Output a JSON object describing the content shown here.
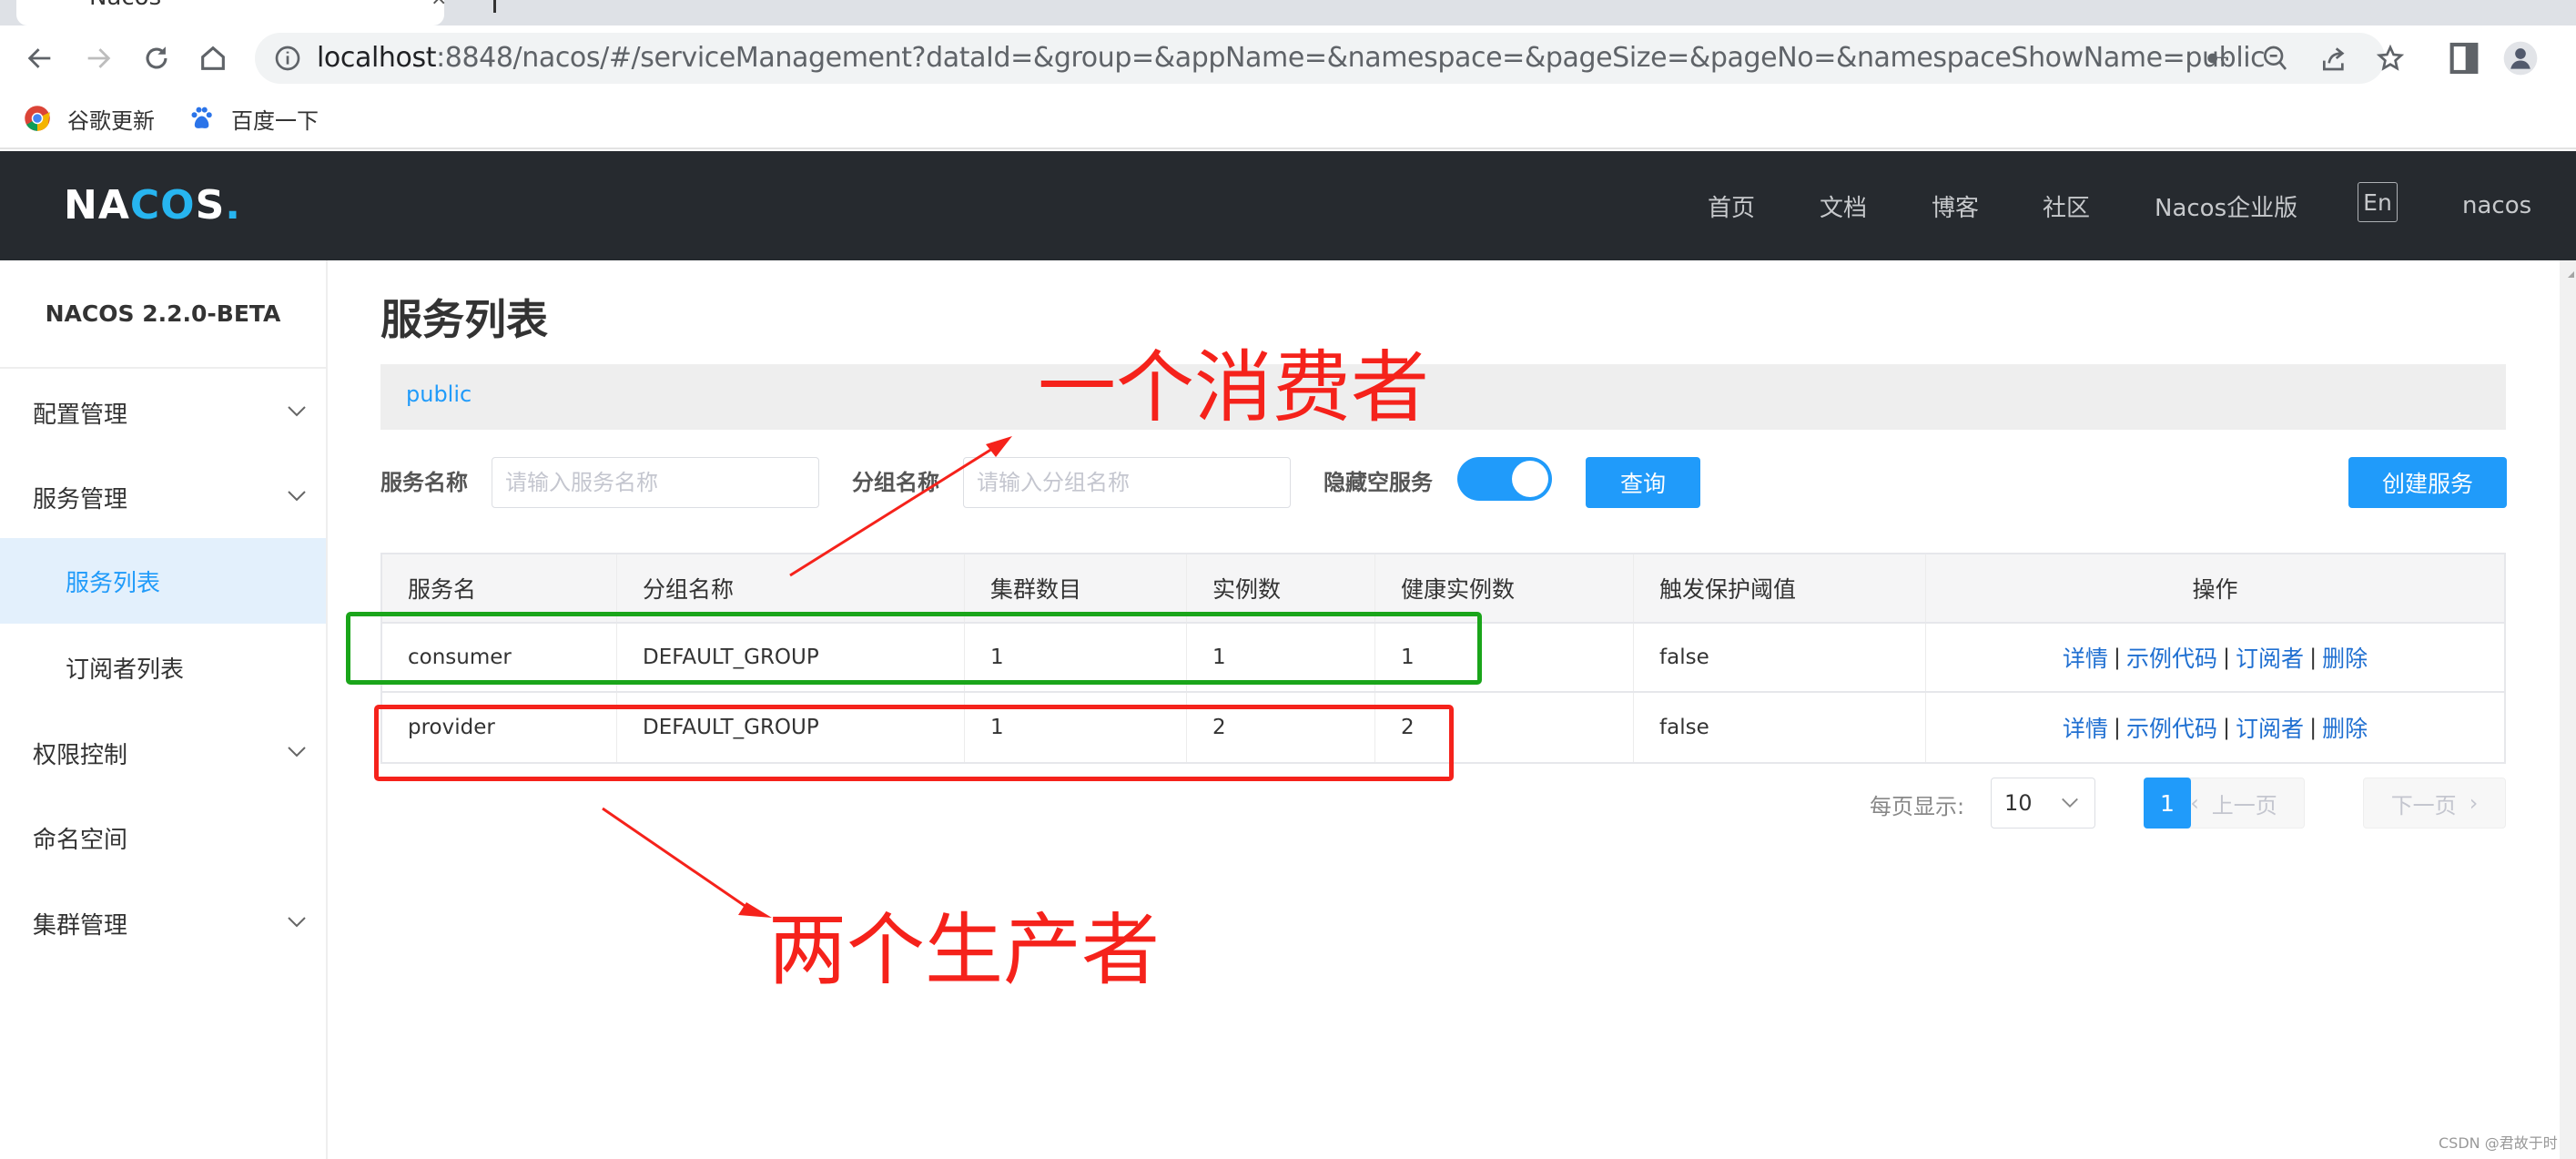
{
  "browser": {
    "tab_title": "Nacos",
    "url_host": "localhost",
    "url_rest": ":8848/nacos/#/serviceManagement?dataId=&group=&appName=&namespace=&pageSize=&pageNo=&namespaceShowName=public",
    "bookmarks": [
      {
        "label": "谷歌更新",
        "icon": "chrome-icon"
      },
      {
        "label": "百度一下",
        "icon": "baidu-paw-icon"
      }
    ]
  },
  "header": {
    "logo_parts": [
      "NA",
      "CO",
      "S",
      "."
    ],
    "nav": [
      "首页",
      "文档",
      "博客",
      "社区",
      "Nacos企业版"
    ],
    "lang": "En",
    "user": "nacos"
  },
  "sidebar": {
    "version": "NACOS 2.2.0-BETA",
    "items": [
      {
        "label": "配置管理",
        "expandable": true
      },
      {
        "label": "服务管理",
        "expandable": true
      },
      {
        "label": "服务列表",
        "sub": true,
        "active": true
      },
      {
        "label": "订阅者列表",
        "sub": true
      },
      {
        "label": "权限控制",
        "expandable": true
      },
      {
        "label": "命名空间",
        "expandable": false
      },
      {
        "label": "集群管理",
        "expandable": true
      }
    ]
  },
  "main": {
    "title": "服务列表",
    "namespace": "public",
    "filters": {
      "service_name_label": "服务名称",
      "service_name_placeholder": "请输入服务名称",
      "service_name_value": "",
      "group_name_label": "分组名称",
      "group_name_placeholder": "请输入分组名称",
      "group_name_value": "",
      "hide_empty_label": "隐藏空服务",
      "hide_empty_on": true,
      "query_button": "查询",
      "create_button": "创建服务"
    },
    "table": {
      "columns": [
        "服务名",
        "分组名称",
        "集群数目",
        "实例数",
        "健康实例数",
        "触发保护阈值",
        "操作"
      ],
      "rows": [
        {
          "service": "consumer",
          "group": "DEFAULT_GROUP",
          "clusters": "1",
          "instances": "1",
          "healthy": "1",
          "protect": "false"
        },
        {
          "service": "provider",
          "group": "DEFAULT_GROUP",
          "clusters": "1",
          "instances": "2",
          "healthy": "2",
          "protect": "false"
        }
      ],
      "ops": [
        "详情",
        "示例代码",
        "订阅者",
        "删除"
      ],
      "op_separator": "|"
    },
    "pagination": {
      "page_size_label": "每页显示:",
      "page_size": "10",
      "prev": "上一页",
      "next": "下一页",
      "current": "1"
    }
  },
  "annotations": {
    "consumer_note": "一个消费者",
    "provider_note": "两个生产者",
    "colors": {
      "red": "#f5221b",
      "green": "#1aa51a"
    }
  },
  "watermark": "CSDN @君故于时",
  "colors": {
    "accent": "#209bfa",
    "header_bg": "#262a2f",
    "link": "#1f6fd1"
  }
}
